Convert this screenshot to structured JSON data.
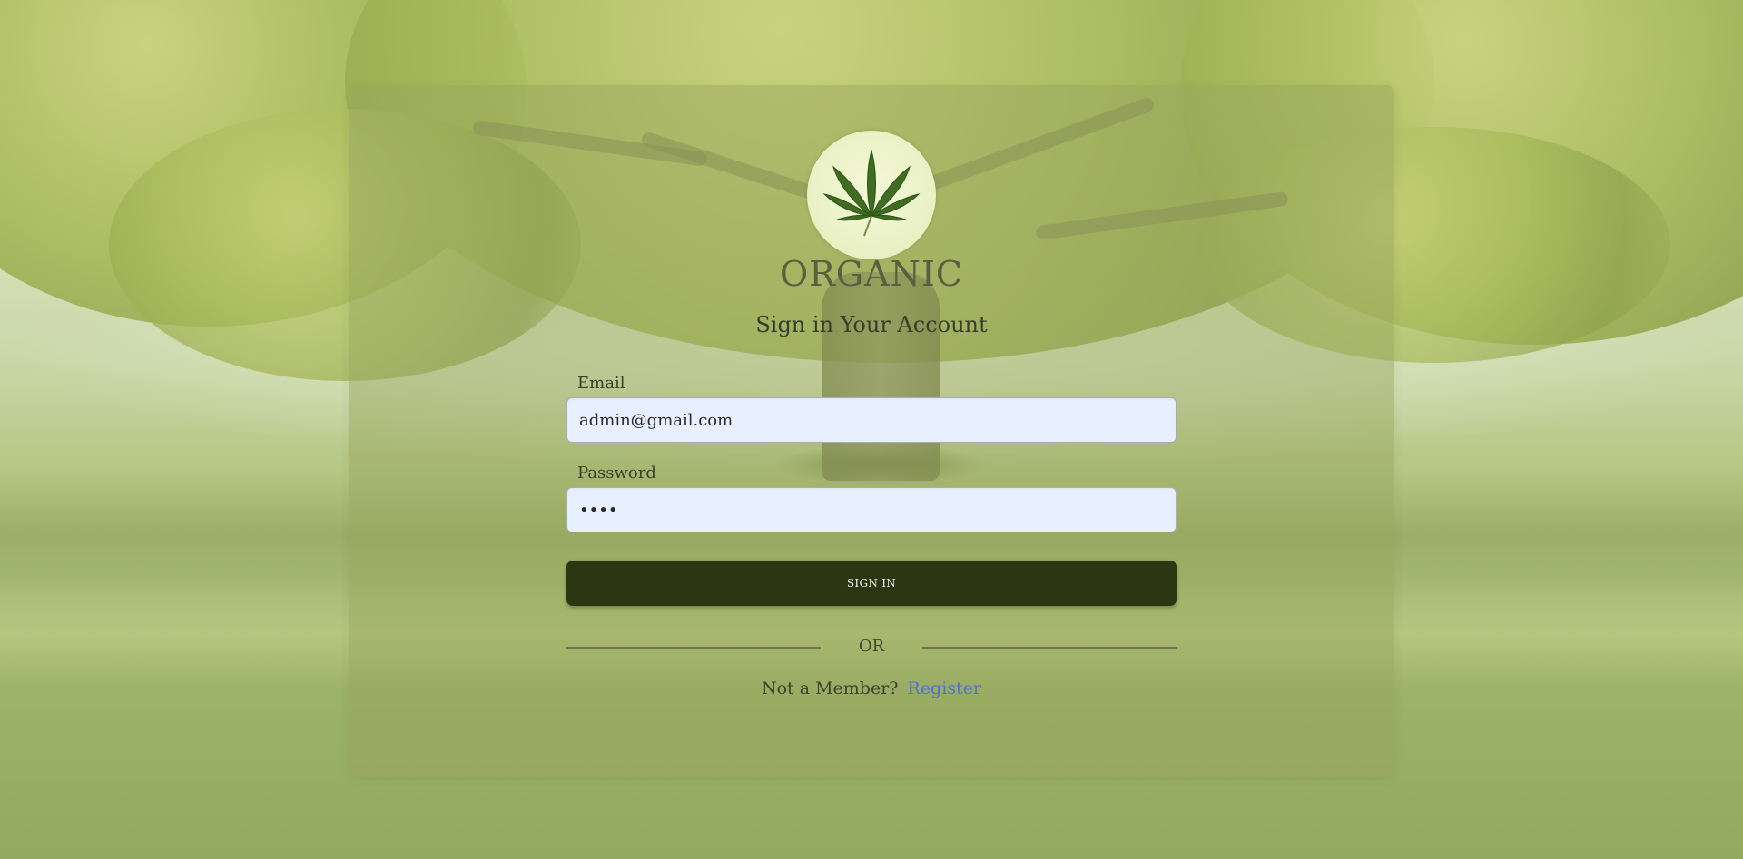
{
  "brand": {
    "name": "ORGANIC",
    "logo_icon": "cannabis-leaf-icon"
  },
  "form": {
    "heading": "Sign in Your Account",
    "email_label": "Email",
    "email_value": "admin@gmail.com",
    "password_label": "Password",
    "password_value": "••••",
    "submit_label": "SIGN IN"
  },
  "divider": {
    "text": "OR"
  },
  "register": {
    "prompt": "Not a Member?",
    "link_label": "Register"
  },
  "colors": {
    "card_overlay": "#96a55a",
    "button_bg": "#2d3613",
    "input_bg": "#e8effe",
    "link": "#4f72d8"
  }
}
